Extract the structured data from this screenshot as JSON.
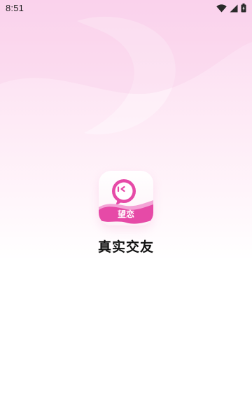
{
  "status_bar": {
    "time": "8:51",
    "icons": [
      "wifi-icon",
      "cell-signal-icon",
      "battery-icon"
    ]
  },
  "splash": {
    "icon_label": "望恋",
    "app_name": "真实交友"
  },
  "colors": {
    "brand_pink": "#e23c9e",
    "brand_pink_light": "#f48fcf",
    "background_top": "#fbd7ef",
    "text_dark": "#111111"
  }
}
